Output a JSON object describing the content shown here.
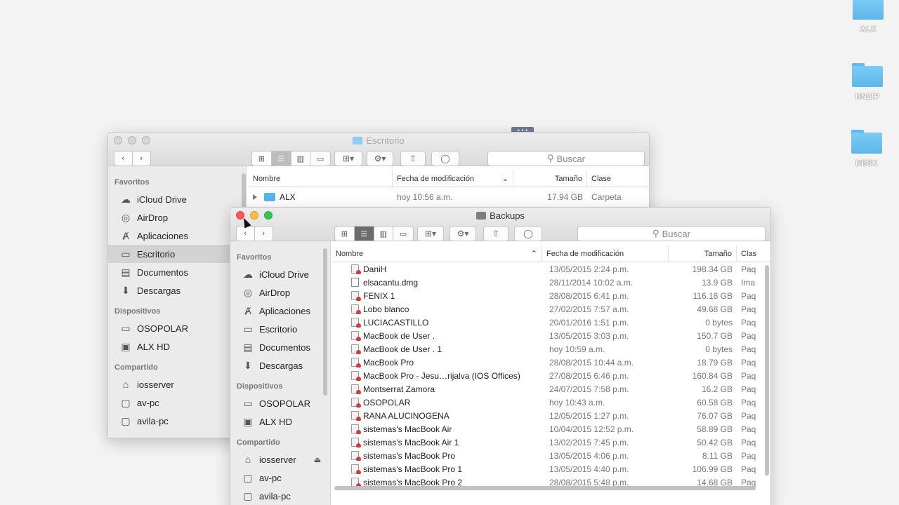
{
  "desktop": {
    "icons": [
      {
        "label": "ALX"
      },
      {
        "label": "UNZIP"
      },
      {
        "label": "DESK"
      }
    ]
  },
  "colors": {
    "close": "#fc5753",
    "minimize": "#fdbc40",
    "zoom": "#33c748",
    "inactive_light": "#d6d6d6",
    "folder": "#5cb7ea"
  },
  "back_window": {
    "title": "Escritorio",
    "search_placeholder": "Buscar",
    "sidebar": {
      "favoritos_header": "Favoritos",
      "favoritos": [
        {
          "label": "iCloud Drive",
          "icon": "cloud-icon"
        },
        {
          "label": "AirDrop",
          "icon": "airdrop-icon"
        },
        {
          "label": "Aplicaciones",
          "icon": "applications-icon"
        },
        {
          "label": "Escritorio",
          "icon": "desktop-icon"
        },
        {
          "label": "Documentos",
          "icon": "documents-icon"
        },
        {
          "label": "Descargas",
          "icon": "downloads-icon"
        }
      ],
      "dispositivos_header": "Dispositivos",
      "dispositivos": [
        {
          "label": "OSOPOLAR",
          "icon": "display-icon"
        },
        {
          "label": "ALX HD",
          "icon": "disk-icon"
        }
      ],
      "compartido_header": "Compartido",
      "compartido": [
        {
          "label": "iosserver",
          "icon": "server-icon"
        },
        {
          "label": "av-pc",
          "icon": "computer-icon"
        },
        {
          "label": "avila-pc",
          "icon": "computer-icon"
        }
      ]
    },
    "columns": {
      "name": "Nombre",
      "date": "Fecha de modificación",
      "size": "Tamaño",
      "kind": "Clase"
    },
    "rows": [
      {
        "name": "ALX",
        "date": "hoy 10:56 a.m.",
        "size": "17.94 GB",
        "kind": "Carpeta"
      }
    ]
  },
  "front_window": {
    "title": "Backups",
    "search_placeholder": "Buscar",
    "sidebar": {
      "favoritos_header": "Favoritos",
      "favoritos": [
        {
          "label": "iCloud Drive",
          "icon": "cloud-icon"
        },
        {
          "label": "AirDrop",
          "icon": "airdrop-icon"
        },
        {
          "label": "Aplicaciones",
          "icon": "applications-icon"
        },
        {
          "label": "Escritorio",
          "icon": "desktop-icon"
        },
        {
          "label": "Documentos",
          "icon": "documents-icon"
        },
        {
          "label": "Descargas",
          "icon": "downloads-icon"
        }
      ],
      "dispositivos_header": "Dispositivos",
      "dispositivos": [
        {
          "label": "OSOPOLAR",
          "icon": "display-icon"
        },
        {
          "label": "ALX HD",
          "icon": "disk-icon"
        }
      ],
      "compartido_header": "Compartido",
      "compartido": [
        {
          "label": "iosserver",
          "icon": "server-icon"
        },
        {
          "label": "av-pc",
          "icon": "computer-icon"
        },
        {
          "label": "avila-pc",
          "icon": "computer-icon"
        }
      ]
    },
    "columns": {
      "name": "Nombre",
      "date": "Fecha de modificación",
      "size": "Tamaño",
      "kind": "Clas"
    },
    "rows": [
      {
        "name": "DaniH",
        "date": "13/05/2015 2:24 p.m.",
        "size": "198.34 GB",
        "kind": "Paq",
        "icon": "backup-icon"
      },
      {
        "name": "elsacantu.dmg",
        "date": "28/11/2014 10:02 a.m.",
        "size": "13.9 GB",
        "kind": "Ima",
        "icon": "dmg-icon"
      },
      {
        "name": "FENIX 1",
        "date": "28/08/2015 6:41 p.m.",
        "size": "116.18 GB",
        "kind": "Paq",
        "icon": "backup-icon"
      },
      {
        "name": "Lobo blanco",
        "date": "27/02/2015 7:57 a.m.",
        "size": "49.68 GB",
        "kind": "Paq",
        "icon": "backup-icon"
      },
      {
        "name": "LUCIACASTILLO",
        "date": "20/01/2016 1:51 p.m.",
        "size": "0 bytes",
        "kind": "Paq",
        "icon": "backup-icon"
      },
      {
        "name": "MacBook de User .",
        "date": "13/05/2015 3:03 p.m.",
        "size": "150.7 GB",
        "kind": "Paq",
        "icon": "backup-icon"
      },
      {
        "name": "MacBook de User . 1",
        "date": "hoy 10:59 a.m.",
        "size": "0 bytes",
        "kind": "Paq",
        "icon": "backup-icon"
      },
      {
        "name": "MacBook Pro",
        "date": "28/08/2015 10:44 a.m.",
        "size": "18.79 GB",
        "kind": "Paq",
        "icon": "backup-icon"
      },
      {
        "name": "MacBook Pro - Jesu…rijalva (IOS Offices)",
        "date": "27/08/2015 6:46 p.m.",
        "size": "160.84 GB",
        "kind": "Paq",
        "icon": "backup-icon"
      },
      {
        "name": "Montserrat Zamora",
        "date": "24/07/2015 7:58 p.m.",
        "size": "16.2 GB",
        "kind": "Paq",
        "icon": "backup-icon"
      },
      {
        "name": "OSOPOLAR",
        "date": "hoy 10:43 a.m.",
        "size": "60.58 GB",
        "kind": "Paq",
        "icon": "backup-icon"
      },
      {
        "name": "RANA ALUCINOGENA",
        "date": "12/05/2015 1:27 p.m.",
        "size": "76.07 GB",
        "kind": "Paq",
        "icon": "backup-icon"
      },
      {
        "name": "sistemas's MacBook Air",
        "date": "10/04/2015 12:52 p.m.",
        "size": "58.89 GB",
        "kind": "Paq",
        "icon": "backup-icon"
      },
      {
        "name": "sistemas's MacBook Air 1",
        "date": "13/02/2015 7:45 p.m.",
        "size": "50.42 GB",
        "kind": "Paq",
        "icon": "backup-icon"
      },
      {
        "name": "sistemas's MacBook Pro",
        "date": "13/05/2015 4:06 p.m.",
        "size": "8.11 GB",
        "kind": "Paq",
        "icon": "backup-icon"
      },
      {
        "name": "sistemas's MacBook Pro 1",
        "date": "13/05/2015 4:40 p.m.",
        "size": "106.99 GB",
        "kind": "Paq",
        "icon": "backup-icon"
      },
      {
        "name": "sistemas's MacBook Pro 2",
        "date": "28/08/2015 5:48 p.m.",
        "size": "14.68 GB",
        "kind": "Paq",
        "icon": "backup-icon"
      }
    ]
  }
}
